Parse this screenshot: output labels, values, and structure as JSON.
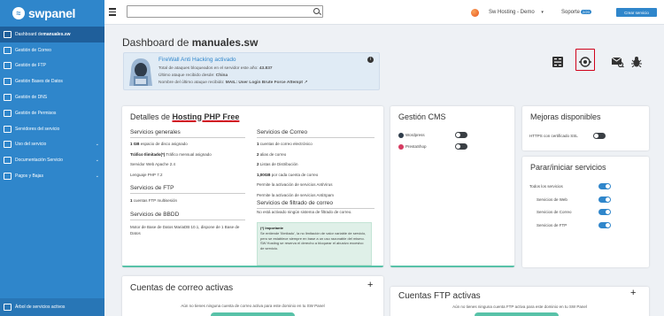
{
  "app": {
    "name": "swpanel"
  },
  "sidebar": {
    "items": [
      {
        "label": "Dashboard de ",
        "strong": "manuales.sw",
        "caret": false
      },
      {
        "label": "Gestión de Correo",
        "caret": false
      },
      {
        "label": "Gestión de FTP",
        "caret": false
      },
      {
        "label": "Gestión Bases de Datos",
        "caret": false
      },
      {
        "label": "Gestión de DNS",
        "caret": false
      },
      {
        "label": "Gestión de Permisos",
        "caret": false
      },
      {
        "label": "Servidores del servicio",
        "caret": false
      },
      {
        "label": "Uso del servicio",
        "caret": true
      },
      {
        "label": "Documentación Servicio",
        "caret": true
      },
      {
        "label": "Pagos y Bajas",
        "caret": true
      }
    ],
    "caret_symbol": "⌄",
    "bottom": "Árbol de servicios activos"
  },
  "topbar": {
    "search_value": "",
    "account": "Sw Hosting - Demo",
    "account_caret": "▾",
    "support": "Soporte",
    "support_badge": "2/20",
    "create_button": "Crear servicio"
  },
  "page": {
    "title_prefix": "Dashboard de ",
    "title_strong": "manuales.sw"
  },
  "firewall": {
    "title": "FireWall Anti Hacking activado",
    "line1_label": "Total de ataques bloqueados en el servidor este año: ",
    "line1_value": "43.837",
    "line2_label": "Último ataque recibido desde: ",
    "line2_value": "China",
    "line3_label": "Nombre del último ataque recibido: ",
    "line3_value": "MAIL: User Login Brute Force Attempt",
    "line3_link": "↗",
    "info": "i"
  },
  "detalles": {
    "heading_prefix": "Detalles de ",
    "heading_strong": "Hosting PHP Free",
    "general": {
      "title": "Servicios generales",
      "items": [
        {
          "b": "1 GB",
          "t": " espacio de disco asignado"
        },
        {
          "b": "Tráfico Ilimitado(*)",
          "t": " Tráfico mensual asignado"
        },
        {
          "b": "",
          "t": "Servidor Web Apache 2.4"
        },
        {
          "b": "",
          "t": "Lenguaje PHP 7.2"
        }
      ]
    },
    "ftp": {
      "title": "Servicios de FTP",
      "items": [
        {
          "b": "1",
          "t": " cuentas FTP multisesión"
        }
      ]
    },
    "bbdd": {
      "title": "Servicios de BBDD",
      "items": [
        {
          "b": "",
          "t": "Motor de Base de Datos MariaDB 10.1, dispone de 1 Base de"
        },
        {
          "b": "",
          "t": "Datos"
        }
      ]
    },
    "correo": {
      "title": "Servicios de Correo",
      "items": [
        {
          "b": "1",
          "t": " cuentas de correo electrónico"
        },
        {
          "b": "2",
          "t": " alias de correo"
        },
        {
          "b": "2",
          "t": " Listas de Distribución"
        },
        {
          "b": "1,00GB",
          "t": " por cada cuenta de correo"
        },
        {
          "b": "",
          "t": "Permite la activación de servicios AntiVirus"
        },
        {
          "b": "",
          "t": "Permite la activación de servicios AntiSpam"
        }
      ]
    },
    "filtrado": {
      "title": "Servicios de filtrado de correo",
      "items": [
        {
          "b": "",
          "t": "No está activado ningún sistema de filtrado de correo."
        }
      ]
    },
    "note": {
      "title": "(*) Importante",
      "text": "Se entiende 'Ilimitado', la no limitación de valor variable de servicio, pero se establece siempre en base a un uso razonable del mismo. SW Hosting se reserva el derecho a bloquear el abusivo excesivo de servicio."
    }
  },
  "cms": {
    "title": "Gestión CMS",
    "items": [
      {
        "label": "Wordpress",
        "on": false
      },
      {
        "label": "PrestaShop",
        "on": false
      }
    ]
  },
  "mejoras": {
    "title": "Mejoras disponibles",
    "items": [
      {
        "label": "HTTPS con certificado SSL",
        "on": false
      }
    ]
  },
  "parar": {
    "title": "Parar/iniciar servicios",
    "items": [
      {
        "label": "Todos los servicios",
        "on": true
      },
      {
        "label": "Servicios de Web",
        "on": true
      },
      {
        "label": "Servicios de Correo",
        "on": true
      },
      {
        "label": "Servicios de FTP",
        "on": true
      }
    ]
  },
  "correo_activas": {
    "title": "Cuentas de correo activas",
    "plus": "+",
    "empty": "Aún no tienes ninguna cuenta de correo activa para este dominio en tu SW Panel"
  },
  "ftp_activas": {
    "title": "Cuentas FTP activas",
    "plus": "+",
    "empty": "Aún no tienes ninguna cuenta FTP activa para este dominio en tu SW Panel"
  },
  "tools": [
    "calculator-icon",
    "web-icon",
    "mail-scan-icon",
    "bug-icon"
  ],
  "colors": {
    "primary": "#2f86cb",
    "sidebar_active": "#1f5f9b",
    "accent_green": "#58c2a8",
    "highlight_red": "#d0021b"
  }
}
